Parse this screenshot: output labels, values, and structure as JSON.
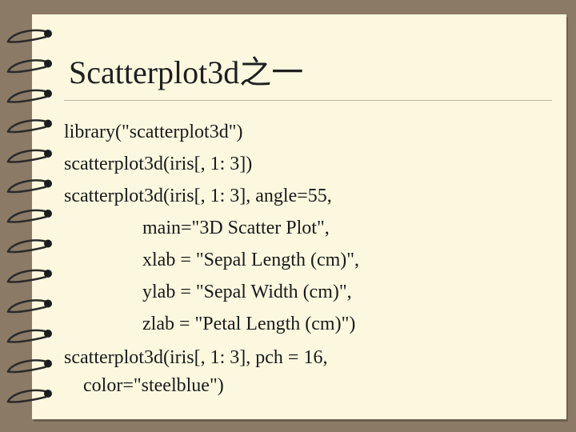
{
  "slide": {
    "title": "Scatterplot3d之一",
    "code_lines": [
      "library(\"scatterplot3d\")",
      "scatterplot3d(iris[, 1: 3])",
      "scatterplot3d(iris[, 1: 3], angle=55,",
      "main=\"3D Scatter Plot\",",
      "xlab = \"Sepal Length (cm)\",",
      "ylab = \"Sepal Width (cm)\",",
      "zlab = \"Petal Length (cm)\")",
      "scatterplot3d(iris[, 1: 3], pch = 16,",
      "color=\"steelblue\")"
    ]
  },
  "colors": {
    "background": "#8b7b66",
    "page": "#fbf8df",
    "text": "#1a1a1a"
  }
}
